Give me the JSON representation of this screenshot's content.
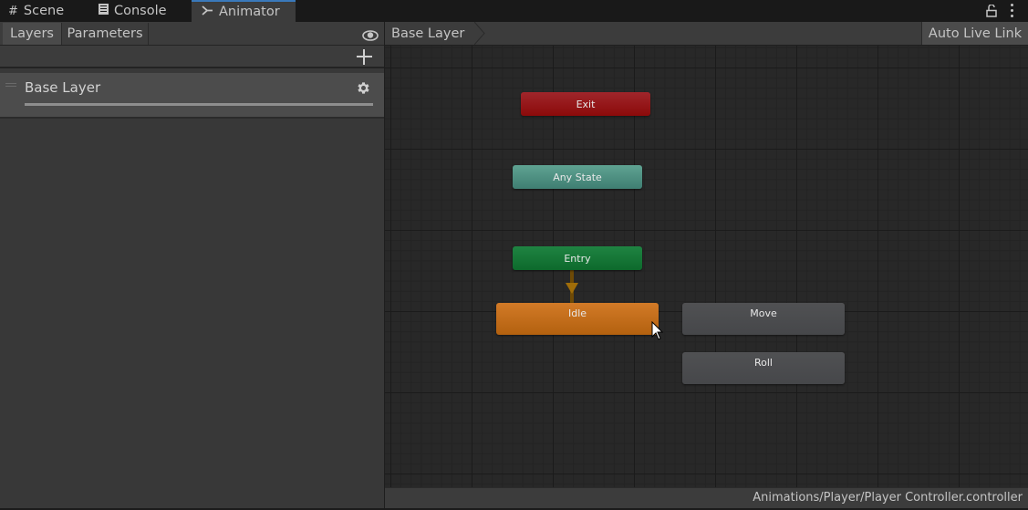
{
  "window_tabs": [
    {
      "label": "Scene",
      "icon": "hash-icon",
      "active": false
    },
    {
      "label": "Console",
      "icon": "console-icon",
      "active": false
    },
    {
      "label": "Animator",
      "icon": "animator-icon",
      "active": true
    }
  ],
  "window_controls": {
    "lock": "lock-icon",
    "menu": "kebab-menu-icon"
  },
  "left_panel": {
    "tabs": [
      {
        "label": "Layers",
        "active": true
      },
      {
        "label": "Parameters",
        "active": false
      }
    ],
    "eye_icon": "eye-icon",
    "add_icon": "plus-icon",
    "layers": [
      {
        "name": "Base Layer",
        "weight": 1.0,
        "settings_icon": "gear-icon"
      }
    ]
  },
  "graph": {
    "breadcrumb": "Base Layer",
    "auto_live_link_label": "Auto Live Link",
    "states": [
      {
        "id": "exit",
        "label": "Exit",
        "color": "#8b0a0a"
      },
      {
        "id": "any",
        "label": "Any State",
        "color": "#4a8c7e"
      },
      {
        "id": "entry",
        "label": "Entry",
        "color": "#117634"
      },
      {
        "id": "idle",
        "label": "Idle",
        "color": "#c46e1b",
        "default": true
      },
      {
        "id": "move",
        "label": "Move",
        "color": "#4a4b4e"
      },
      {
        "id": "roll",
        "label": "Roll",
        "color": "#4a4b4e"
      }
    ],
    "transitions": [
      {
        "from": "Entry",
        "to": "Idle"
      }
    ]
  },
  "status_bar": {
    "path": "Animations/Player/Player Controller.controller"
  }
}
